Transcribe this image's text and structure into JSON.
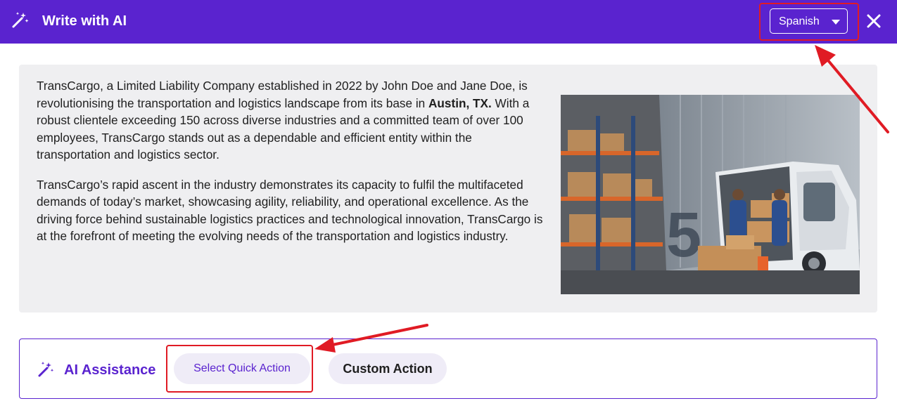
{
  "header": {
    "title": "Write with AI",
    "language_selected": "Spanish",
    "icons": {
      "wand": "magic-wand-icon",
      "caret": "chevron-down-icon",
      "close": "close-icon"
    }
  },
  "content": {
    "paragraph1_before_bold": "TransCargo, a Limited Liability Company established in 2022 by John Doe and Jane Doe, is revolutionising the transportation and logistics landscape from its base in ",
    "paragraph1_bold": "Austin, TX.",
    "paragraph1_after_bold": " With a robust clientele exceeding 150 across diverse industries and a committed team of over 100 employees, TransCargo stands out as a dependable and efficient entity within the transportation and logistics sector.",
    "paragraph2": "TransCargo’s rapid ascent in the industry demonstrates its capacity to fulfil the multifaceted demands of today’s market, showcasing agility, reliability, and operational excellence. As the driving force behind sustainable logistics practices and technological innovation, TransCargo is at the forefront of meeting the evolving needs of the transportation and logistics industry."
  },
  "ai_assistance": {
    "title": "AI Assistance",
    "quick_action_label": "Select Quick Action",
    "custom_action_label": "Custom Action"
  },
  "colors": {
    "brand": "#5a23cf",
    "card_bg": "#efeff1",
    "pill_bg": "#efecf7",
    "annotation": "#e01b24"
  }
}
